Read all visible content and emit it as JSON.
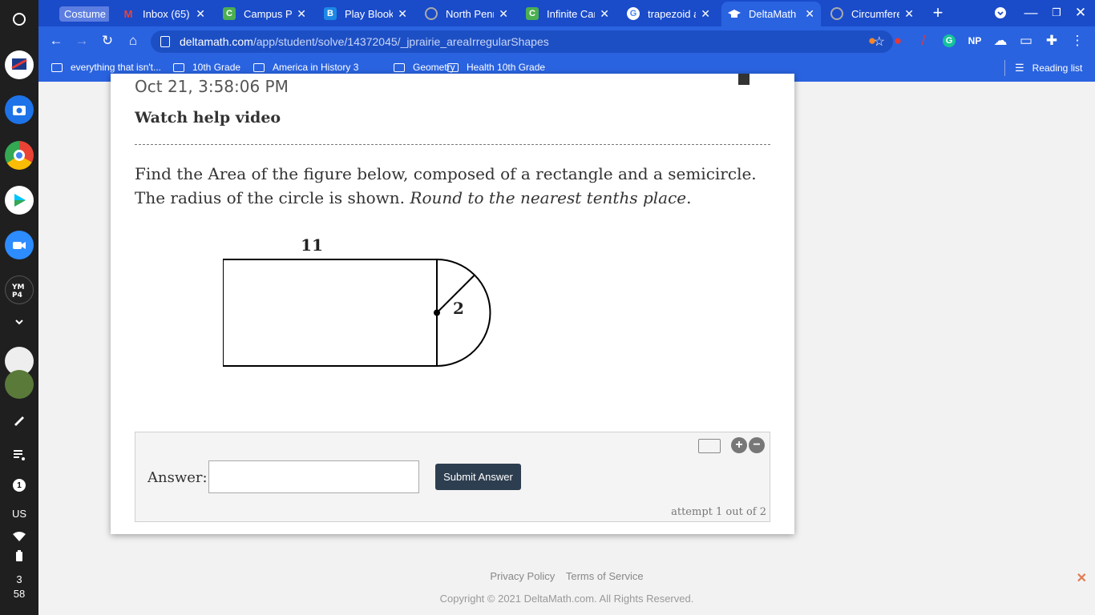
{
  "shelf": {
    "notification_count": "1",
    "keyboard_layout": "US",
    "time_hour": "3",
    "time_minute": "58",
    "launcher_icon": "circle-launcher-icon"
  },
  "tabs": [
    {
      "title": "Costume",
      "icon": "pill",
      "color": "#5d7ee0"
    },
    {
      "title": "Inbox (65) -",
      "icon": "gmail",
      "color": "#ea4335"
    },
    {
      "title": "Campus Po",
      "icon": "C",
      "color": "#4caf50"
    },
    {
      "title": "Play Blooke",
      "icon": "B",
      "color": "#1e88e5"
    },
    {
      "title": "North Penn",
      "icon": "clock",
      "color": "#888"
    },
    {
      "title": "Infinite Can",
      "icon": "C",
      "color": "#4caf50"
    },
    {
      "title": "trapezoid a",
      "icon": "G",
      "color": "#ffffff"
    },
    {
      "title": "DeltaMath",
      "icon": "cap",
      "color": "#2a63e0",
      "active": true
    },
    {
      "title": "Circumfere",
      "icon": "clock",
      "color": "#888"
    }
  ],
  "toolbar": {
    "url_host": "deltamath.com",
    "url_path": "/app/student/solve/14372045/_jprairie_areaIrregularShapes"
  },
  "bookmarks": [
    {
      "label": "everything that isn't...",
      "type": "page"
    },
    {
      "label": "10th Grade",
      "type": "folder"
    },
    {
      "label": "America in History 3",
      "type": "folder"
    },
    {
      "label": "Geometry",
      "type": "folder"
    },
    {
      "label": "Health 10th Grade",
      "type": "folder"
    }
  ],
  "reading_list": "Reading list",
  "problem": {
    "timestamp": "Oct 21, 3:58:06 PM",
    "help_link": "Watch help video",
    "question_text": "Find the Area of the figure below, composed of a rectangle and a semicircle. The radius of the circle is shown.",
    "question_emphasis": "Round to the nearest tenths place",
    "question_end": ".",
    "figure": {
      "rect_length_label": "11",
      "radius_label": "2"
    }
  },
  "answer": {
    "label": "Answer:",
    "value": "",
    "submit_label": "Submit Answer",
    "attempt_text": "attempt 1 out of 2"
  },
  "footer": {
    "privacy": "Privacy Policy",
    "terms": "Terms of Service",
    "copyright": "Copyright © 2021 DeltaMath.com. All Rights Reserved."
  },
  "colors": {
    "tabstrip": "#1a4bc9",
    "toolbar": "#2a63e0",
    "submit_button": "#2d3e50",
    "close_accent": "#e07b53"
  }
}
